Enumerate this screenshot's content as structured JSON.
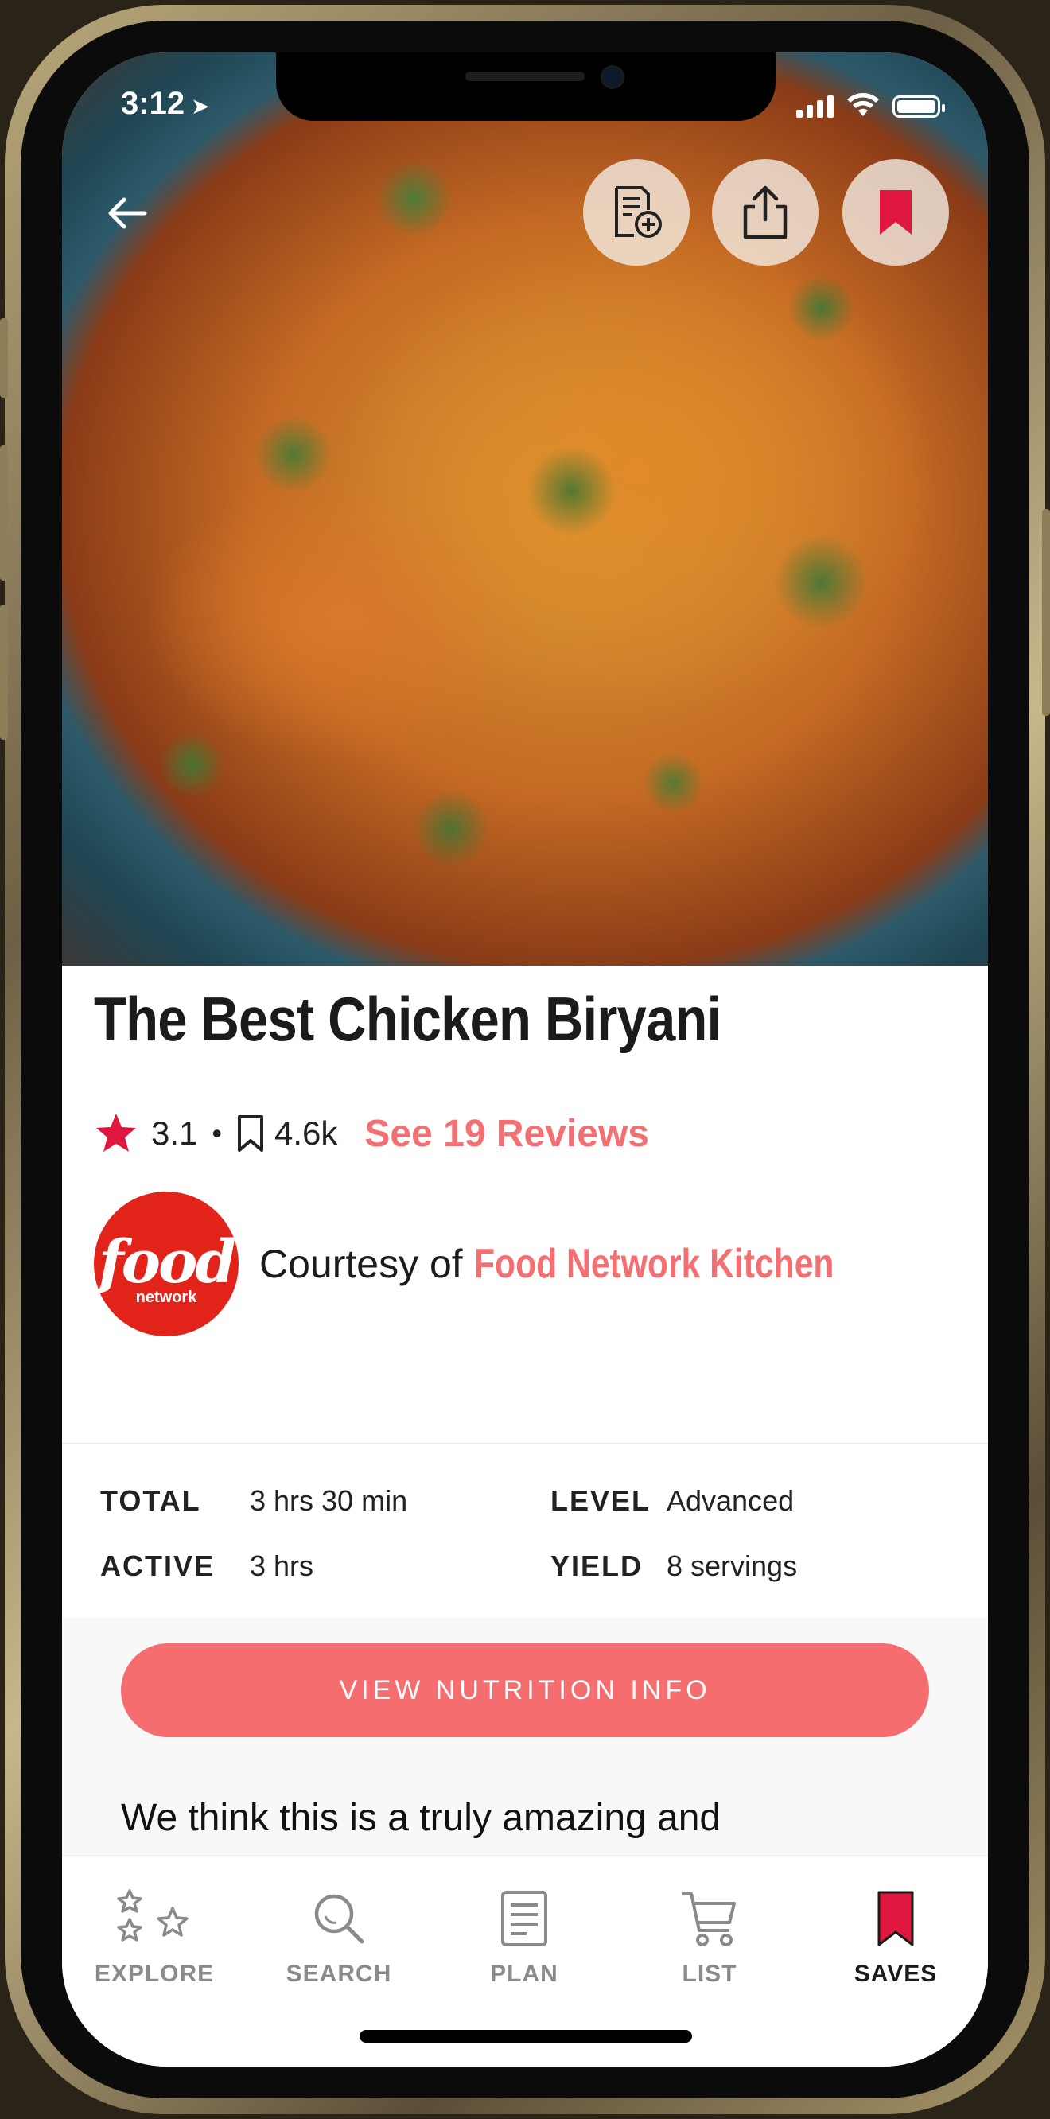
{
  "status_bar": {
    "time": "3:12",
    "location_glyph": "➤"
  },
  "recipe": {
    "title": "The Best Chicken Biryani",
    "rating": "3.1",
    "saves": "4.6k",
    "reviews_link": "See 19 Reviews",
    "courtesy_prefix": "Courtesy of",
    "source_name": "Food Network Kitchen",
    "source_logo": {
      "word": "food",
      "sub": "network"
    }
  },
  "info": {
    "total_label": "TOTAL",
    "total_value": "3 hrs 30 min",
    "active_label": "ACTIVE",
    "active_value": "3 hrs",
    "level_label": "LEVEL",
    "level_value": "Advanced",
    "yield_label": "YIELD",
    "yield_value": "8 servings"
  },
  "nutrition_button": "VIEW NUTRITION INFO",
  "description": "We think this is a truly amazing and",
  "tabs": [
    {
      "label": "EXPLORE",
      "icon": "stars-icon"
    },
    {
      "label": "SEARCH",
      "icon": "search-icon"
    },
    {
      "label": "PLAN",
      "icon": "plan-icon"
    },
    {
      "label": "LIST",
      "icon": "cart-icon"
    },
    {
      "label": "SAVES",
      "icon": "bookmark-icon",
      "active": true
    }
  ],
  "colors": {
    "accent": "#f36f72",
    "button": "#f56d6f",
    "bookmark": "#e0173f",
    "logo_red": "#e2231a"
  }
}
